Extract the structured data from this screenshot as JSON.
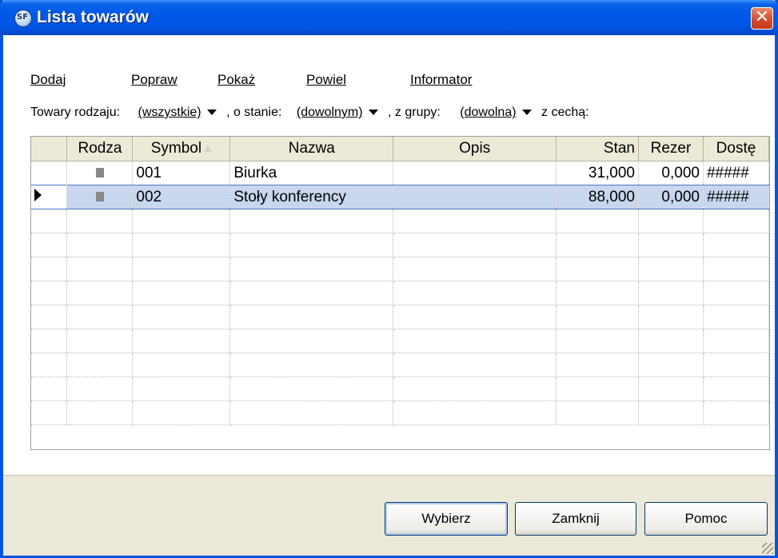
{
  "window": {
    "title": "Lista towarów",
    "close_symbol": "✕"
  },
  "toolbar": {
    "add": "Dodaj",
    "edit": "Popraw",
    "show": "Pokaż",
    "duplicate": "Powiel",
    "info": "Informator"
  },
  "filters": {
    "kind_label": "Towary rodzaju:",
    "kind_value": "(wszystkie)",
    "state_label": ", o stanie:",
    "state_value": "(dowolnym)",
    "group_label": ", z grupy:",
    "group_value": "(dowolna)",
    "feature_label": "z cechą:"
  },
  "table": {
    "columns": [
      "Rodza",
      "Symbol",
      "Nazwa",
      "Opis",
      "Stan",
      "Rezer",
      "Dostę"
    ],
    "rows": [
      {
        "symbol": "001",
        "name": "Biurka",
        "desc": "",
        "stock": "31,000",
        "reserved": "0,000",
        "available": "#####"
      },
      {
        "symbol": "002",
        "name": "Stoły konferency",
        "desc": "",
        "stock": "88,000",
        "reserved": "0,000",
        "available": "#####"
      }
    ],
    "selected_row": 1,
    "empty_rows": 9
  },
  "buttons": {
    "select": "Wybierz",
    "close": "Zamknij",
    "help": "Pomoc"
  },
  "colors": {
    "title_bar": "#0058e6",
    "selection": "#c8d6ee",
    "face": "#ece9d8"
  }
}
